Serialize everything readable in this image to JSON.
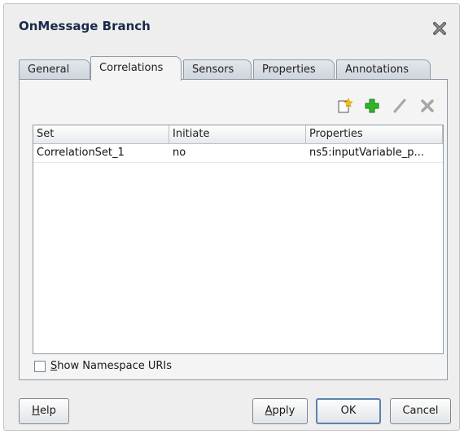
{
  "dialog": {
    "title": "OnMessage Branch"
  },
  "tabs": [
    {
      "label": "General"
    },
    {
      "label": "Correlations",
      "active": true
    },
    {
      "label": "Sensors"
    },
    {
      "label": "Properties"
    },
    {
      "label": "Annotations"
    }
  ],
  "toolbar": {
    "icons": [
      "new-document-icon",
      "add-icon",
      "edit-icon",
      "delete-icon"
    ]
  },
  "table": {
    "headers": [
      "Set",
      "Initiate",
      "Properties"
    ],
    "rows": [
      [
        "CorrelationSet_1",
        "no",
        "ns5:inputVariable_p..."
      ]
    ]
  },
  "options": {
    "show_ns_mnemonic": "S",
    "show_ns_rest": "how Namespace URIs",
    "show_ns_checked": false
  },
  "buttons": {
    "help_mnemonic": "H",
    "help_rest": "elp",
    "apply_mnemonic": "A",
    "apply_rest": "pply",
    "ok": "OK",
    "cancel": "Cancel"
  },
  "colors": {
    "add_green": "#2fb52a",
    "title_navy": "#1a2a4a",
    "ok_border": "#5a82b0"
  }
}
